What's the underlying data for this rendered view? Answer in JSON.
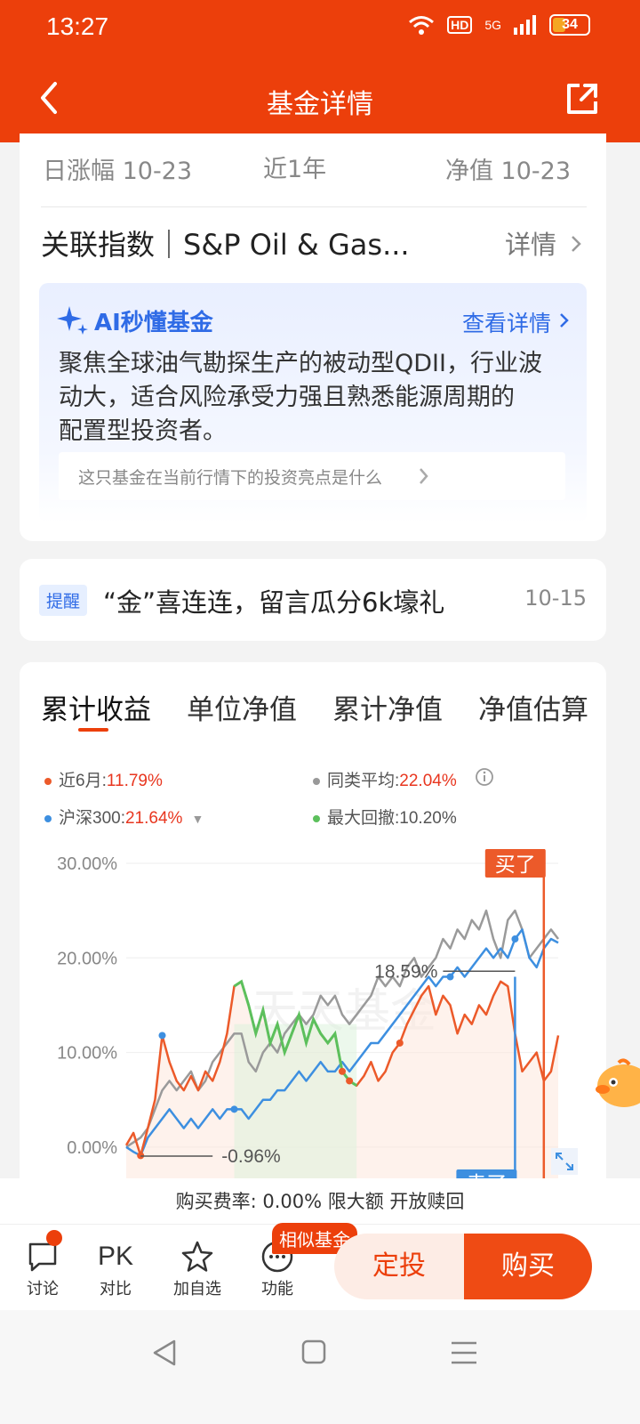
{
  "status_bar": {
    "time": "13:27",
    "network": "5G",
    "hd": "HD",
    "battery": "34"
  },
  "header": {
    "title": "基金详情"
  },
  "summary_labels": {
    "daily_change": "日涨幅 10-23",
    "period": "近1年",
    "nav": "净值 10-23"
  },
  "related_index": {
    "label": "关联指数｜S&P Oil & Gas...",
    "detail": "详情"
  },
  "ai": {
    "title": "AI秒懂基金",
    "link": "查看详情",
    "summary_line1": "聚焦全球油气勘探生产的被动型QDII，行业波",
    "summary_line2": "动大，适合风险承受力强且熟悉能源周期的",
    "summary_line3": "配置型投资者。",
    "question": "这只基金在当前行情下的投资亮点是什么"
  },
  "notice": {
    "tag": "提醒",
    "text": "“金”喜连连，留言瓜分6k壕礼",
    "date": "10-15"
  },
  "chart_tabs": [
    "累计收益",
    "单位净值",
    "累计净值",
    "净值估算"
  ],
  "legend": {
    "fund_label": "近6月:",
    "fund_value": "11.79%",
    "peer_label": "同类平均:",
    "peer_value": "22.04%",
    "index_label": "沪深300:",
    "index_value": "21.64%",
    "drawdown_label": "最大回撤:",
    "drawdown_value": "10.20%"
  },
  "colors": {
    "brand": "#ec3f0b",
    "fund": "#ec5a2a",
    "peer": "#9a9a9a",
    "index": "#3d8fe0",
    "drawdown": "#5cc05c"
  },
  "chart_data": {
    "type": "line",
    "y_ticks": [
      "30.00%",
      "20.00%",
      "10.00%",
      "0.00%"
    ],
    "ylim": [
      -5,
      30
    ],
    "watermark": "天天基金",
    "annotations": {
      "high": "18.59%",
      "low": "-0.96%",
      "buy": "买了",
      "sell": "卖了"
    },
    "x": [
      0,
      1,
      2,
      3,
      4,
      5,
      6,
      7,
      8,
      9,
      10,
      11,
      12,
      13,
      14,
      15,
      16,
      17,
      18,
      19,
      20,
      21,
      22,
      23,
      24,
      25,
      26,
      27,
      28,
      29,
      30,
      31,
      32,
      33,
      34,
      35,
      36,
      37,
      38,
      39,
      40,
      41,
      42,
      43,
      44,
      45,
      46,
      47,
      48,
      49,
      50,
      51,
      52,
      53,
      54,
      55,
      56,
      57,
      58,
      59,
      60
    ],
    "series": [
      {
        "name": "近6月",
        "values": [
          0.2,
          1.5,
          -0.9,
          2,
          5,
          11.8,
          9,
          7,
          6,
          7.5,
          6,
          8,
          7,
          9,
          12,
          17,
          17.5,
          15,
          12,
          14.5,
          11,
          13,
          10,
          12,
          14,
          11,
          13.5,
          12,
          11,
          12,
          8,
          7,
          6.5,
          7.5,
          9,
          7,
          8,
          10,
          11,
          13,
          14.5,
          16,
          17,
          14,
          16,
          15,
          12,
          14,
          13,
          15,
          14,
          16,
          17.5,
          17,
          12,
          8,
          9,
          10,
          7,
          8,
          11.8
        ]
      },
      {
        "name": "同类平均",
        "values": [
          0,
          0.5,
          1,
          2,
          4,
          6,
          7,
          6,
          7,
          8,
          6,
          7,
          9,
          10,
          11,
          12,
          12,
          9,
          8,
          10,
          11,
          10,
          12,
          13,
          14,
          13,
          14,
          16,
          15,
          16,
          14,
          13,
          14,
          15,
          16,
          18,
          17,
          18,
          17,
          19,
          20,
          18,
          19,
          20,
          22,
          21,
          23,
          22,
          24,
          23,
          25,
          22,
          20,
          24,
          25,
          23,
          20,
          21,
          22,
          23,
          22
        ]
      },
      {
        "name": "沪深300",
        "values": [
          0,
          -0.5,
          -0.9,
          1,
          2,
          3,
          4,
          3,
          2,
          3,
          2,
          3,
          4,
          3,
          4,
          4,
          4,
          3,
          4,
          5,
          5,
          6,
          6,
          7,
          8,
          7,
          8,
          9,
          8,
          8,
          9,
          8,
          9,
          10,
          11,
          11,
          12,
          13,
          14,
          15,
          16,
          17,
          18,
          17,
          18,
          18,
          19,
          18,
          19,
          20,
          21,
          20,
          21,
          20,
          22,
          23,
          20,
          19,
          21,
          22,
          21.6
        ]
      }
    ]
  },
  "fee": "购买费率: 0.00% 限大额 开放赎回",
  "actions": {
    "discuss": "讨论",
    "pk_icon": "PK",
    "compare": "对比",
    "watch": "加自选",
    "func": "功能",
    "similar": "相似基金",
    "sip": "定投",
    "buy": "购买"
  }
}
